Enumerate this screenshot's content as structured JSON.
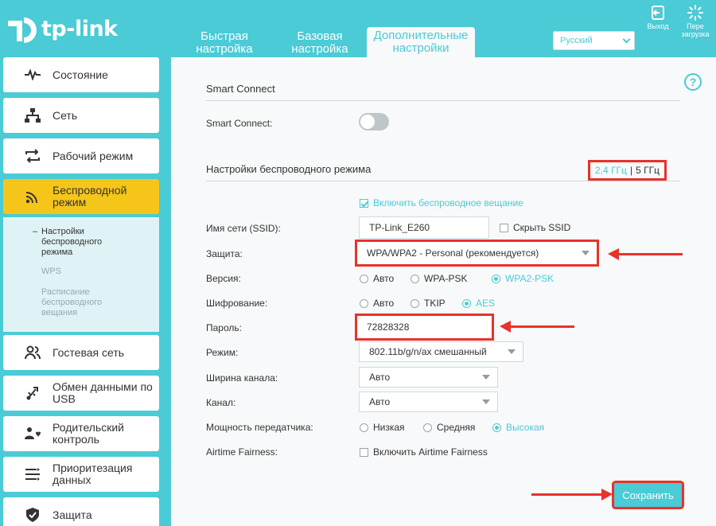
{
  "brand": {
    "name": "tp-link"
  },
  "colors": {
    "accent": "#4acbd6",
    "active_nav": "#f5c51a",
    "highlight": "#e8322a"
  },
  "tabs": [
    {
      "label": "Быстрая настройка"
    },
    {
      "label": "Базовая настройка"
    },
    {
      "label": "Дополнительные настройки",
      "active": true
    }
  ],
  "language": {
    "selected": "Русский"
  },
  "header_buttons": {
    "logout": "Выход",
    "reboot": "Пере загрузка"
  },
  "sidebar": {
    "items": [
      {
        "label": "Состояние",
        "icon": "pulse-icon"
      },
      {
        "label": "Сеть",
        "icon": "network-icon"
      },
      {
        "label": "Рабочий режим",
        "icon": "mode-switch-icon"
      },
      {
        "label": "Беспроводной режим",
        "icon": "wifi-icon",
        "active": true
      },
      {
        "label": "Гостевая сеть",
        "icon": "guests-icon"
      },
      {
        "label": "Обмен данными по USB",
        "icon": "usb-icon"
      },
      {
        "label": "Родительский контроль",
        "icon": "parental-icon"
      },
      {
        "label": "Приоритезация данных",
        "icon": "priority-icon"
      },
      {
        "label": "Защита",
        "icon": "shield-icon"
      }
    ],
    "submenu": [
      {
        "label": "Настройки беспроводного режима",
        "active": true
      },
      {
        "label": "WPS"
      },
      {
        "label": "Расписание беспроводного вещания"
      }
    ]
  },
  "smart_connect": {
    "title": "Smart Connect",
    "label": "Smart Connect:",
    "enabled": false
  },
  "wireless": {
    "title": "Настройки беспроводного режима",
    "freq_24": "2,4 ГГц",
    "freq_sep": "|",
    "freq_5": "5 ГГц",
    "enable_broadcast": "Включить беспроводное вещание",
    "ssid_label": "Имя сети (SSID):",
    "ssid_value": "TP-Link_E260",
    "hide_ssid": "Скрыть SSID",
    "security_label": "Защита:",
    "security_value": "WPA/WPA2 - Personal (рекомендуется)",
    "version_label": "Версия:",
    "version_options": [
      "Авто",
      "WPA-PSK",
      "WPA2-PSK"
    ],
    "version_selected": 2,
    "encryption_label": "Шифрование:",
    "encryption_options": [
      "Авто",
      "TKIP",
      "AES"
    ],
    "encryption_selected": 2,
    "password_label": "Пароль:",
    "password_value": "72828328",
    "mode_label": "Режим:",
    "mode_value": "802.11b/g/n/ax смешанный",
    "channel_width_label": "Ширина канала:",
    "channel_width_value": "Авто",
    "channel_label": "Канал:",
    "channel_value": "Авто",
    "tx_power_label": "Мощность передатчика:",
    "tx_power_options": [
      "Низкая",
      "Средняя",
      "Высокая"
    ],
    "tx_power_selected": 2,
    "airtime_label": "Airtime Fairness:",
    "airtime_option": "Включить Airtime Fairness"
  },
  "save_label": "Сохранить"
}
